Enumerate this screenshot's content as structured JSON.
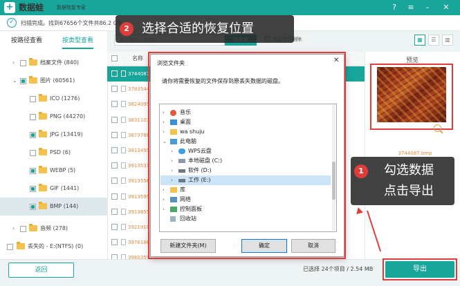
{
  "app": {
    "name": "数据蛙",
    "subtitle": "数据恢复专家"
  },
  "titlebar": {
    "help_icon": "help-icon",
    "menu_icon": "menu-icon",
    "minimize_icon": "minimize-icon",
    "close_icon": "close-icon"
  },
  "status": {
    "text": "扫描完成。找到67656个文件共86.2 GB"
  },
  "tabs": [
    {
      "label": "按路径查看"
    },
    {
      "label": "按类型查看"
    }
  ],
  "filter": {
    "placeholder": "在这里输入文件名",
    "button": "筛选器",
    "only_deleted": "仅显示已删除"
  },
  "tree": [
    {
      "label": "档案文件 (840)"
    },
    {
      "label": "图片 (60561)"
    },
    {
      "label": "ICO (1276)"
    },
    {
      "label": "PNG (44270)"
    },
    {
      "label": "JPG (13419)"
    },
    {
      "label": "PSD (6)"
    },
    {
      "label": "WEBP (5)"
    },
    {
      "label": "GIF (1441)"
    },
    {
      "label": "BMP (144)"
    },
    {
      "label": "音频 (278)"
    },
    {
      "label": "丢失的 - E:(NTFS) (0)"
    }
  ],
  "list": {
    "name_header": "名称",
    "rows": [
      "3744087",
      "3783544",
      "3824095",
      "3831103",
      "3873768",
      "3913495",
      "3913531",
      "3913556",
      "3913595",
      "3913655",
      "3921910",
      "3976186",
      "3980359"
    ]
  },
  "preview": {
    "title": "预览",
    "filename": "3744087.bmp"
  },
  "callouts": {
    "step2": {
      "num": "2",
      "text": "选择合适的恢复位置"
    },
    "step1": {
      "num": "1",
      "line1": "勾选数据",
      "line2": "点击导出"
    }
  },
  "dialog": {
    "title": "浏览文件夹",
    "message": "请你将需要恢复的文件保存到原丢失数据的磁盘。",
    "items": [
      {
        "label": "音乐"
      },
      {
        "label": "桌面"
      },
      {
        "label": "wa shuju"
      },
      {
        "label": "此电脑"
      },
      {
        "label": "WPS云盘"
      },
      {
        "label": "本地磁盘 (C:)"
      },
      {
        "label": "软件 (D:)"
      },
      {
        "label": "工作 (E:)"
      },
      {
        "label": "库"
      },
      {
        "label": "网络"
      },
      {
        "label": "控制面板"
      },
      {
        "label": "回收站"
      }
    ],
    "new_folder": "新建文件夹(M)",
    "ok": "确定",
    "cancel": "取消"
  },
  "bottom": {
    "back": "返回",
    "selected": "已选择 24个项目 / 2.54 MB",
    "export": "导出"
  },
  "colors": {
    "accent": "#19a69a",
    "annotation": "#e03c3c"
  }
}
